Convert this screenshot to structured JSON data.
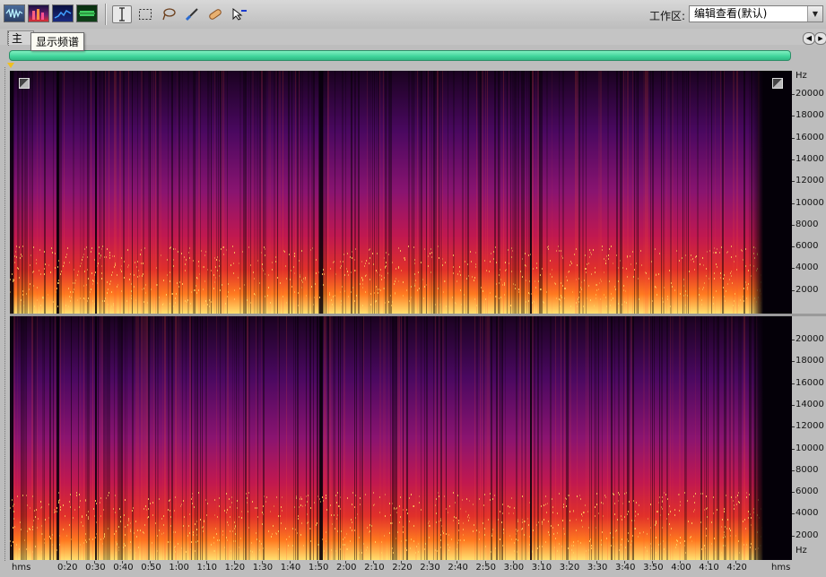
{
  "toolbar": {
    "view_buttons": [
      "waveform-view-icon",
      "spectral-view-icon",
      "spectral-pitch-icon",
      "waveform-green-icon"
    ],
    "tools": [
      "time-selection-icon",
      "marquee-selection-icon",
      "lasso-selection-icon",
      "brush-selection-icon",
      "spot-healing-icon",
      "move-tool-icon"
    ],
    "workspace_label": "工作区:",
    "workspace_value": "编辑查看(默认)"
  },
  "colors": {
    "overview": "#3fd49a",
    "spectrogram_bg": "#05000a",
    "playhead": "#f0c020"
  },
  "tab": {
    "label": "主",
    "tooltip": "显示频谱"
  },
  "frequency_axis": {
    "unit": "Hz",
    "top_labels": [
      "20000",
      "18000",
      "16000",
      "14000",
      "12000",
      "10000",
      "8000",
      "6000",
      "4000",
      "2000"
    ],
    "bottom_labels": [
      "20000",
      "18000",
      "16000",
      "14000",
      "12000",
      "10000",
      "8000",
      "6000",
      "4000",
      "2000"
    ]
  },
  "time_axis": {
    "unit": "hms",
    "labels": [
      "0:20",
      "0:30",
      "0:40",
      "0:50",
      "1:00",
      "1:10",
      "1:20",
      "1:30",
      "1:40",
      "1:50",
      "2:00",
      "2:10",
      "2:20",
      "2:30",
      "2:40",
      "2:50",
      "3:00",
      "3:10",
      "3:20",
      "3:30",
      "3:40",
      "3:50",
      "4:00",
      "4:10",
      "4:20"
    ]
  }
}
